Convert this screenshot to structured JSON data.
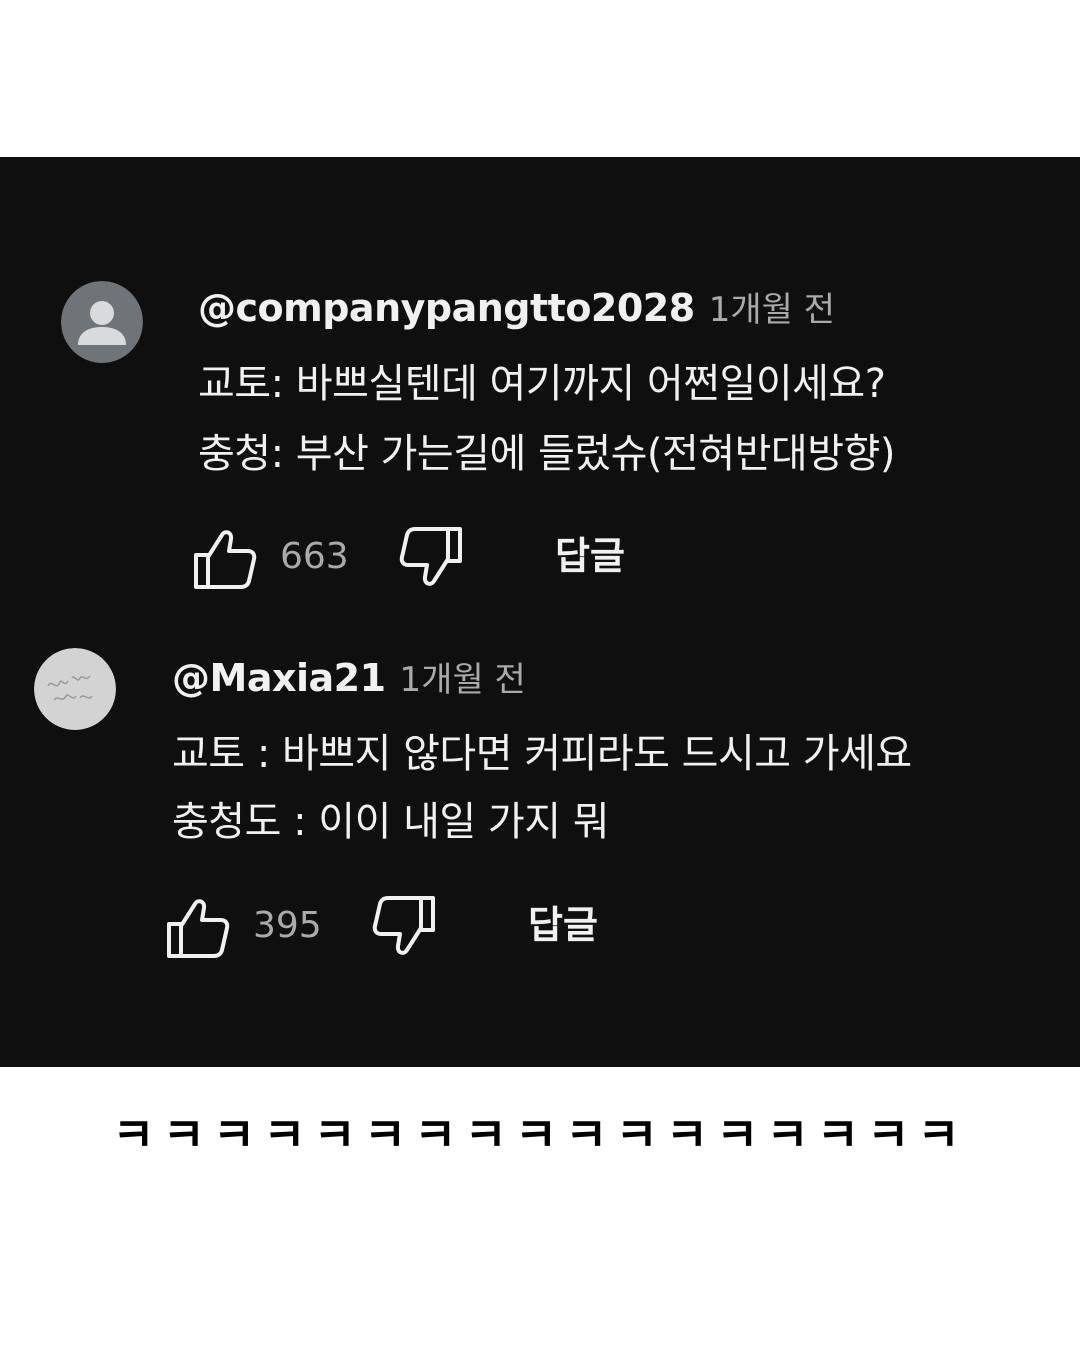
{
  "comments": [
    {
      "username": "@companypangtto2028",
      "timestamp": "1개월 전",
      "avatar_icon": "default-person-avatar",
      "lines": [
        "교토: 바쁘실텐데 여기까지 어쩐일이세요?",
        "충청: 부산 가는길에 들렀슈(전혀반대방향)"
      ],
      "likes": "663",
      "reply_label": "답글"
    },
    {
      "username": "@Maxia21",
      "timestamp": "1개월 전",
      "avatar_icon": "handwritten-avatar",
      "lines": [
        "교토 : 바쁘지 않다면 커피라도 드시고 가세요",
        "충청도 : 이이 내일 가지 뭐"
      ],
      "likes": "395",
      "reply_label": "답글"
    }
  ],
  "caption": "ㅋㅋㅋㅋㅋㅋㅋㅋㅋㅋㅋㅋㅋㅋㅋㅋㅋ",
  "colors": {
    "background": "#0f0f0f",
    "text_primary": "#f1f1f1",
    "text_secondary": "#aaaaaa",
    "page_background": "#ffffff"
  }
}
